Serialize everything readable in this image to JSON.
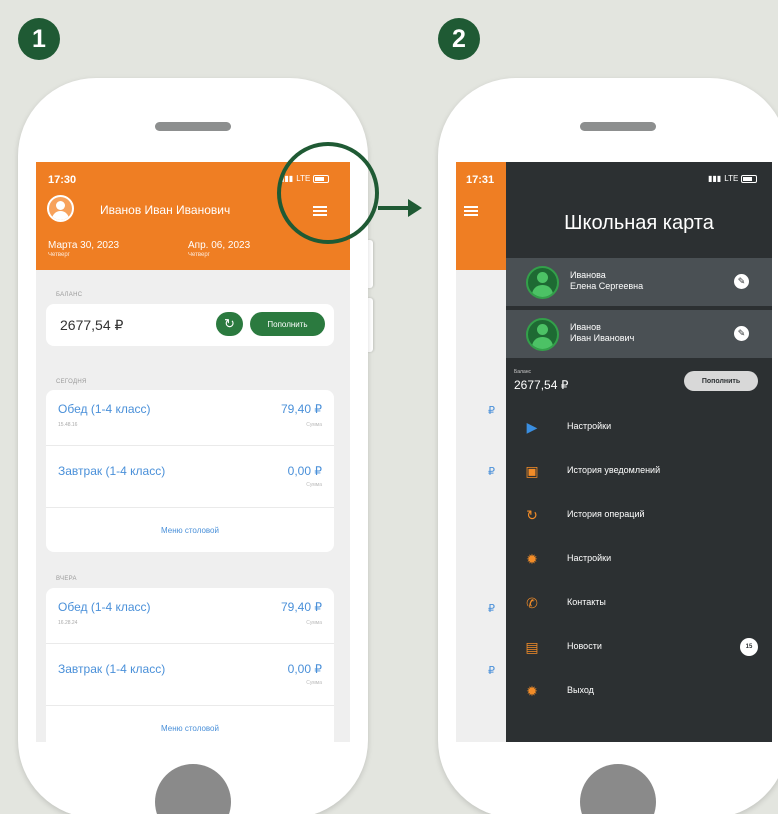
{
  "steps": [
    "1",
    "2"
  ],
  "screen1": {
    "status": {
      "time": "17:30",
      "network": "LTE"
    },
    "header": {
      "user_name": "Иванов Иван Иванович"
    },
    "dates": [
      {
        "date": "Марта 30, 2023",
        "weekday": "Четверг"
      },
      {
        "date": "Апр. 06, 2023",
        "weekday": "Четверг"
      }
    ],
    "balance": {
      "label": "БАЛАНС",
      "value": "2677,54 ₽",
      "refresh_icon": "↻",
      "topup_label": "Пополнить"
    },
    "today": {
      "label": "СЕГОДНЯ",
      "meals": [
        {
          "name": "Обед (1-4 класс)",
          "sub": "15.48.16",
          "price": "79,40 ₽",
          "unit": "Сумма"
        },
        {
          "name": "Завтрак (1-4 класс)",
          "sub": "",
          "price": "0,00 ₽",
          "unit": "Сумма"
        }
      ],
      "menu_link": "Меню столовой"
    },
    "yesterday": {
      "label": "ВЧЕРА",
      "meals": [
        {
          "name": "Обед (1-4 класс)",
          "sub": "16.28.24",
          "price": "79,40 ₽",
          "unit": "Сумма"
        },
        {
          "name": "Завтрак (1-4 класс)",
          "sub": "",
          "price": "0,00 ₽",
          "unit": "Сумма"
        }
      ],
      "menu_link": "Меню столовой"
    }
  },
  "screen2": {
    "status": {
      "time": "17:31",
      "network": "LTE"
    },
    "drawer": {
      "title": "Школьная карта",
      "profiles": [
        {
          "name_line1": "Иванова",
          "name_line2": "Елена Сергеевна"
        },
        {
          "name_line1": "Иванов",
          "name_line2": "Иван Иванович"
        }
      ],
      "balance_label": "Баланс",
      "balance_value": "2677,54 ₽",
      "topup_label": "Пополнить",
      "menu": [
        {
          "label": "Настройки",
          "icon": "settings-icon",
          "glyph": "▶"
        },
        {
          "label": "История уведомлений",
          "icon": "notifications-history-icon",
          "glyph": "▣"
        },
        {
          "label": "История операций",
          "icon": "operations-history-icon",
          "glyph": "↻"
        },
        {
          "label": "Настройки",
          "icon": "gear-icon",
          "glyph": "✹"
        },
        {
          "label": "Контакты",
          "icon": "phone-icon",
          "glyph": "✆"
        },
        {
          "label": "Новости",
          "icon": "news-icon",
          "glyph": "▤",
          "badge": "15"
        },
        {
          "label": "Выход",
          "icon": "logout-icon",
          "glyph": "✹"
        }
      ]
    },
    "background_prices": [
      "₽",
      "₽",
      "₽",
      "₽"
    ]
  },
  "colors": {
    "brand_orange": "#ef7e23",
    "brand_green": "#2b7a3f",
    "accent_dark_green": "#1f5a34",
    "drawer_bg": "#2c3032",
    "link_blue": "#4a90d9"
  }
}
